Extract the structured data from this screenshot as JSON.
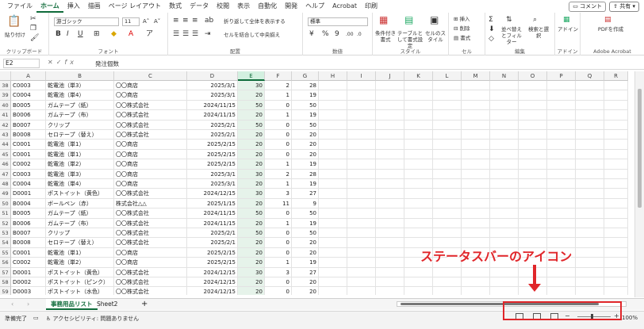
{
  "menu": {
    "tabs": [
      "ファイル",
      "ホーム",
      "挿入",
      "描画",
      "ページ レイアウト",
      "数式",
      "データ",
      "校閲",
      "表示",
      "自動化",
      "開発",
      "ヘルプ",
      "Acrobat",
      "印刷"
    ],
    "active_index": 1,
    "comment_label": "コメント",
    "share_label": "共有"
  },
  "ribbon": {
    "clipboard": {
      "paste": "貼り付け",
      "label": "クリップボード"
    },
    "font": {
      "name": "游ゴシック",
      "size": "11",
      "label": "フォント"
    },
    "alignment": {
      "wrap": "折り返して全体を表示する",
      "merge": "セルを結合して中央揃え",
      "label": "配置"
    },
    "number": {
      "format": "標準",
      "label": "数値"
    },
    "styles": {
      "cond": "条件付き書式",
      "table": "テーブルとして書式設定",
      "cell": "セルのスタイル",
      "label": "スタイル"
    },
    "cells": {
      "insert": "挿入",
      "delete": "削除",
      "format": "書式",
      "label": "セル"
    },
    "editing": {
      "sort": "並べ替えとフィルター",
      "find": "検索と選択",
      "label": "編集"
    },
    "addin": {
      "name": "アドイン",
      "label": "アドイン"
    },
    "acrobat": {
      "name": "PDFを作成",
      "label": "Adobe Acrobat"
    }
  },
  "formula": {
    "cell_ref": "E2",
    "value": "発注個数"
  },
  "columns": [
    "A",
    "B",
    "C",
    "D",
    "E",
    "F",
    "G",
    "H",
    "I",
    "J",
    "K",
    "L",
    "M",
    "N",
    "O",
    "P",
    "Q",
    "R"
  ],
  "selected_column": "E",
  "rows": [
    {
      "n": "38",
      "a": "C0003",
      "b": "乾電池（単3）",
      "c": "〇〇商店",
      "d": "2025/3/1",
      "e": "30",
      "f": "2",
      "g": "28"
    },
    {
      "n": "39",
      "a": "C0004",
      "b": "乾電池（単4）",
      "c": "〇〇商店",
      "d": "2025/3/1",
      "e": "20",
      "f": "1",
      "g": "19"
    },
    {
      "n": "40",
      "a": "B0005",
      "b": "ガムテープ（紙）",
      "c": "〇〇株式会社",
      "d": "2024/11/15",
      "e": "50",
      "f": "0",
      "g": "50"
    },
    {
      "n": "41",
      "a": "B0006",
      "b": "ガムテープ（布）",
      "c": "〇〇株式会社",
      "d": "2024/11/15",
      "e": "20",
      "f": "1",
      "g": "19"
    },
    {
      "n": "42",
      "a": "B0007",
      "b": "クリップ",
      "c": "〇〇株式会社",
      "d": "2025/2/1",
      "e": "50",
      "f": "0",
      "g": "50"
    },
    {
      "n": "43",
      "a": "B0008",
      "b": "セロテープ（替え）",
      "c": "〇〇株式会社",
      "d": "2025/2/1",
      "e": "20",
      "f": "0",
      "g": "20"
    },
    {
      "n": "44",
      "a": "C0001",
      "b": "乾電池（単1）",
      "c": "〇〇商店",
      "d": "2025/2/15",
      "e": "20",
      "f": "0",
      "g": "20"
    },
    {
      "n": "45",
      "a": "C0001",
      "b": "乾電池（単1）",
      "c": "〇〇商店",
      "d": "2025/2/15",
      "e": "20",
      "f": "0",
      "g": "20"
    },
    {
      "n": "46",
      "a": "C0002",
      "b": "乾電池（単2）",
      "c": "〇〇商店",
      "d": "2025/2/15",
      "e": "20",
      "f": "1",
      "g": "19"
    },
    {
      "n": "47",
      "a": "C0003",
      "b": "乾電池（単3）",
      "c": "〇〇商店",
      "d": "2025/3/1",
      "e": "30",
      "f": "2",
      "g": "28"
    },
    {
      "n": "48",
      "a": "C0004",
      "b": "乾電池（単4）",
      "c": "〇〇商店",
      "d": "2025/3/1",
      "e": "20",
      "f": "1",
      "g": "19"
    },
    {
      "n": "49",
      "a": "D0001",
      "b": "ポストイット（黄色）",
      "c": "〇〇株式会社",
      "d": "2024/12/15",
      "e": "30",
      "f": "3",
      "g": "27"
    },
    {
      "n": "50",
      "a": "B0004",
      "b": "ボールペン（赤）",
      "c": "株式会社△△",
      "d": "2025/1/15",
      "e": "20",
      "f": "11",
      "g": "9"
    },
    {
      "n": "51",
      "a": "B0005",
      "b": "ガムテープ（紙）",
      "c": "〇〇株式会社",
      "d": "2024/11/15",
      "e": "50",
      "f": "0",
      "g": "50"
    },
    {
      "n": "52",
      "a": "B0006",
      "b": "ガムテープ（布）",
      "c": "〇〇株式会社",
      "d": "2024/11/15",
      "e": "20",
      "f": "1",
      "g": "19"
    },
    {
      "n": "53",
      "a": "B0007",
      "b": "クリップ",
      "c": "〇〇株式会社",
      "d": "2025/2/1",
      "e": "50",
      "f": "0",
      "g": "50"
    },
    {
      "n": "54",
      "a": "B0008",
      "b": "セロテープ（替え）",
      "c": "〇〇株式会社",
      "d": "2025/2/1",
      "e": "20",
      "f": "0",
      "g": "20"
    },
    {
      "n": "55",
      "a": "C0001",
      "b": "乾電池（単1）",
      "c": "〇〇商店",
      "d": "2025/2/15",
      "e": "20",
      "f": "0",
      "g": "20"
    },
    {
      "n": "56",
      "a": "C0002",
      "b": "乾電池（単2）",
      "c": "〇〇商店",
      "d": "2025/2/15",
      "e": "20",
      "f": "1",
      "g": "19"
    },
    {
      "n": "57",
      "a": "D0001",
      "b": "ポストイット（黄色）",
      "c": "〇〇株式会社",
      "d": "2024/12/15",
      "e": "30",
      "f": "3",
      "g": "27"
    },
    {
      "n": "58",
      "a": "D0002",
      "b": "ポストイット（ピンク）",
      "c": "〇〇株式会社",
      "d": "2024/12/15",
      "e": "20",
      "f": "0",
      "g": "20"
    },
    {
      "n": "59",
      "a": "D0003",
      "b": "ポストイット（水色）",
      "c": "〇〇株式会社",
      "d": "2024/12/15",
      "e": "20",
      "f": "0",
      "g": "20"
    }
  ],
  "sheets": {
    "tabs": [
      "事務用品リスト",
      "Sheet2"
    ],
    "active_index": 0,
    "add": "+"
  },
  "status": {
    "ready": "準備完了",
    "accessibility": "アクセシビリティ: 問題ありません",
    "zoom": "100%"
  },
  "annotation": {
    "text": "ステータスバーのアイコン",
    "color": "#e0262a"
  }
}
